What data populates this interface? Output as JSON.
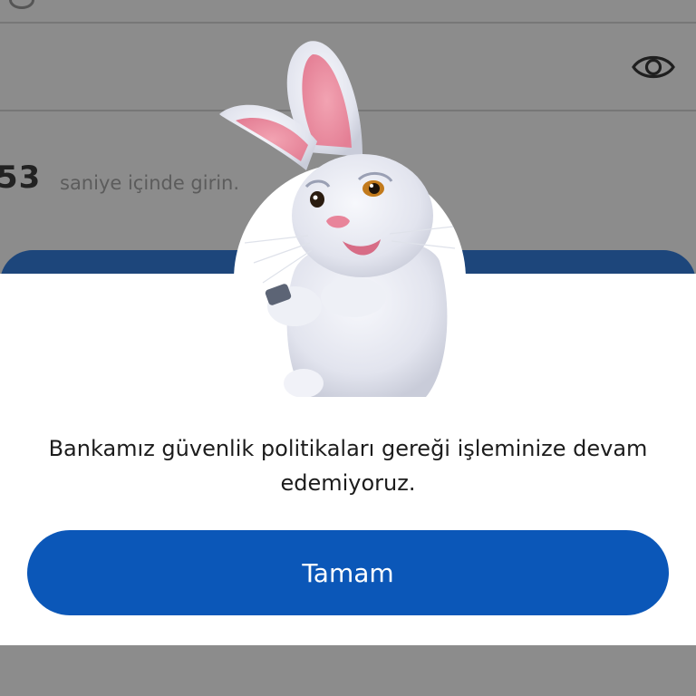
{
  "background": {
    "countdown_value": "53",
    "countdown_label": "saniye içinde girin.",
    "password_toggle_icon": "eye-icon",
    "brand_band_color": "#1d467b"
  },
  "dialog": {
    "mascot": "rabbit-mascot",
    "message": "Bankamız güvenlik politikaları gereği işleminize devam edemiyoruz.",
    "ok_label": "Tamam",
    "ok_color": "#0b57b8"
  }
}
